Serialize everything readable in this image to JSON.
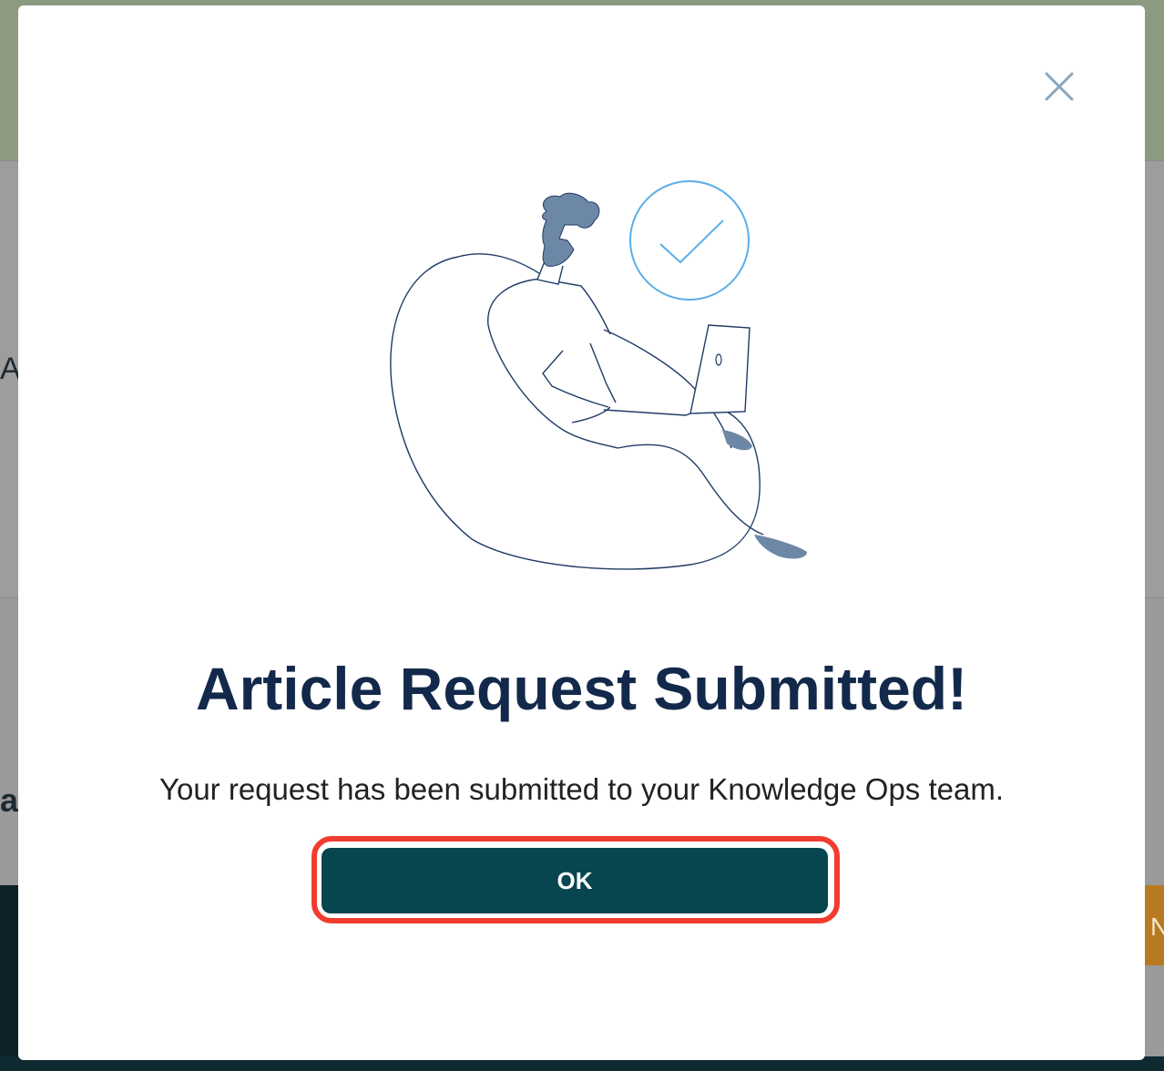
{
  "dialog": {
    "title": "Article Request Submitted!",
    "message": "Your request has been submitted to your Knowledge Ops team.",
    "ok_label": "OK",
    "close_icon": "close-icon",
    "illustration": "person-on-beanbag-with-laptop-illustration",
    "check_icon": "checkmark-circle-icon"
  },
  "background": {
    "partial_text_left_1": "A",
    "partial_text_left_2": "al",
    "partial_text_right": "N"
  },
  "colors": {
    "title": "#13294b",
    "button": "#08464f",
    "highlight": "#f03c2e",
    "illustration_stroke": "#1f3b66",
    "illustration_fill": "#6d87a6",
    "check": "#5aaee8",
    "close_icon": "#8aa6bc"
  }
}
